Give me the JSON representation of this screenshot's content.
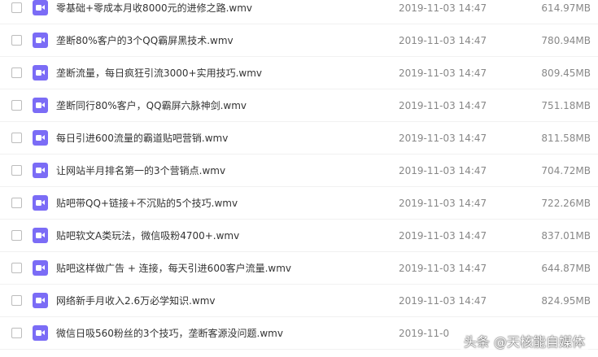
{
  "files": [
    {
      "name": "零基础+零成本月收8000元的进修之路.wmv",
      "date": "2019-11-03 14:47",
      "size": "614.97MB"
    },
    {
      "name": "垄断80%客户的3个QQ霸屏黑技术.wmv",
      "date": "2019-11-03 14:47",
      "size": "780.94MB"
    },
    {
      "name": "垄断流量，每日疯狂引流3000+实用技巧.wmv",
      "date": "2019-11-03 14:47",
      "size": "809.45MB"
    },
    {
      "name": "垄断同行80%客户，QQ霸屏六脉神剑.wmv",
      "date": "2019-11-03 14:47",
      "size": "751.18MB"
    },
    {
      "name": "每日引进600流量的霸道贴吧营销.wmv",
      "date": "2019-11-03 14:47",
      "size": "811.58MB"
    },
    {
      "name": "让网站半月排名第一的3个营销点.wmv",
      "date": "2019-11-03 14:47",
      "size": "704.72MB"
    },
    {
      "name": "贴吧带QQ+链接+不沉贴的5个技巧.wmv",
      "date": "2019-11-03 14:47",
      "size": "722.26MB"
    },
    {
      "name": "贴吧软文A类玩法，微信吸粉4700+.wmv",
      "date": "2019-11-03 14:47",
      "size": "837.01MB"
    },
    {
      "name": "贴吧这样做广告 + 连接，每天引进600客户流量.wmv",
      "date": "2019-11-03 14:47",
      "size": "644.87MB"
    },
    {
      "name": "网络新手月收入2.6万必学知识.wmv",
      "date": "2019-11-03 14:47",
      "size": "824.95MB"
    },
    {
      "name": "微信日吸560粉丝的3个技巧，垄断客源没问题.wmv",
      "date": "2019-11-0",
      "size": ""
    }
  ],
  "file_icon": "video-file-icon",
  "colors": {
    "icon_bg": "#7b6cf6",
    "text": "#333333",
    "meta_text": "#888888"
  },
  "watermark": "头条 @天核能自媒体"
}
